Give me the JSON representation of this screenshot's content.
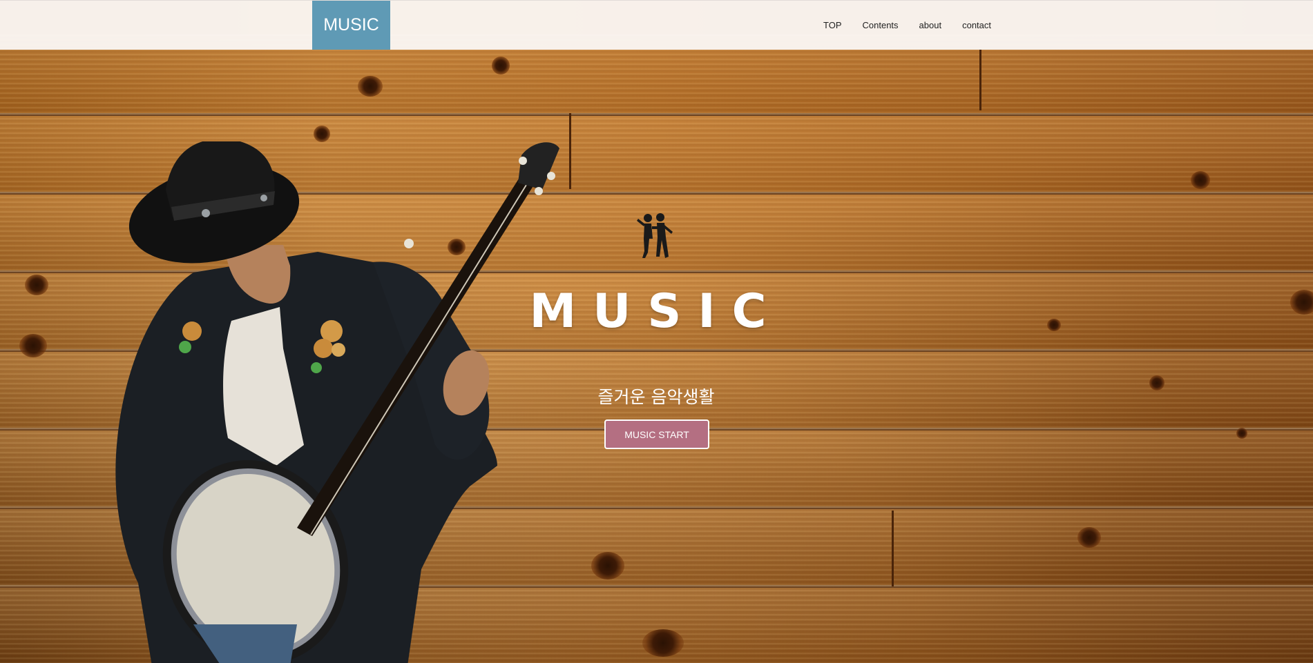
{
  "navbar": {
    "brand": "MUSIC",
    "links": [
      "TOP",
      "Contents",
      "about",
      "contact"
    ]
  },
  "hero": {
    "title": "MUSIC",
    "subtitle": "즐거운 음악생활",
    "cta_label": "MUSIC START"
  },
  "colors": {
    "brand_bg": "#5f9ab5",
    "cta_bg": "#b46f82",
    "navbar_bg": "#faf6f3",
    "wood": "#b8712a"
  },
  "icons": {
    "dancers": "dancing-couple-icon"
  }
}
